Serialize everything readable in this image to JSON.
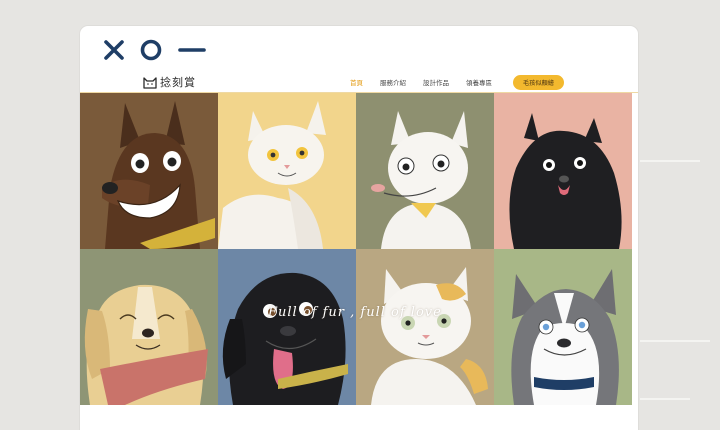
{
  "site": {
    "brand_name": "捻刻賞",
    "logo_text": "XO—"
  },
  "nav": {
    "items": [
      {
        "label": "首頁",
        "active": true
      },
      {
        "label": "服務介紹",
        "active": false
      },
      {
        "label": "設計作品",
        "active": false
      },
      {
        "label": "領養專區",
        "active": false
      }
    ],
    "cta_label": "毛孩似顏繪"
  },
  "hero": {
    "tagline": "Full of fur , full of love"
  },
  "colors": {
    "accent": "#f3b92e",
    "active_nav": "#e39a10",
    "logo": "#1f3e66",
    "tile_backgrounds": [
      "#7a5a3a",
      "#f2d58c",
      "#8e9070",
      "#e9b3a3",
      "#8e9575",
      "#6d87a6",
      "#b9a782",
      "#a8b787"
    ]
  },
  "tiles": [
    {
      "animal": "doberman-dog-icon"
    },
    {
      "animal": "white-cat-icon"
    },
    {
      "animal": "white-cat-smiling-icon"
    },
    {
      "animal": "black-pomeranian-icon"
    },
    {
      "animal": "golden-retriever-icon"
    },
    {
      "animal": "black-labrador-icon"
    },
    {
      "animal": "calico-cat-icon"
    },
    {
      "animal": "husky-dog-icon"
    }
  ]
}
